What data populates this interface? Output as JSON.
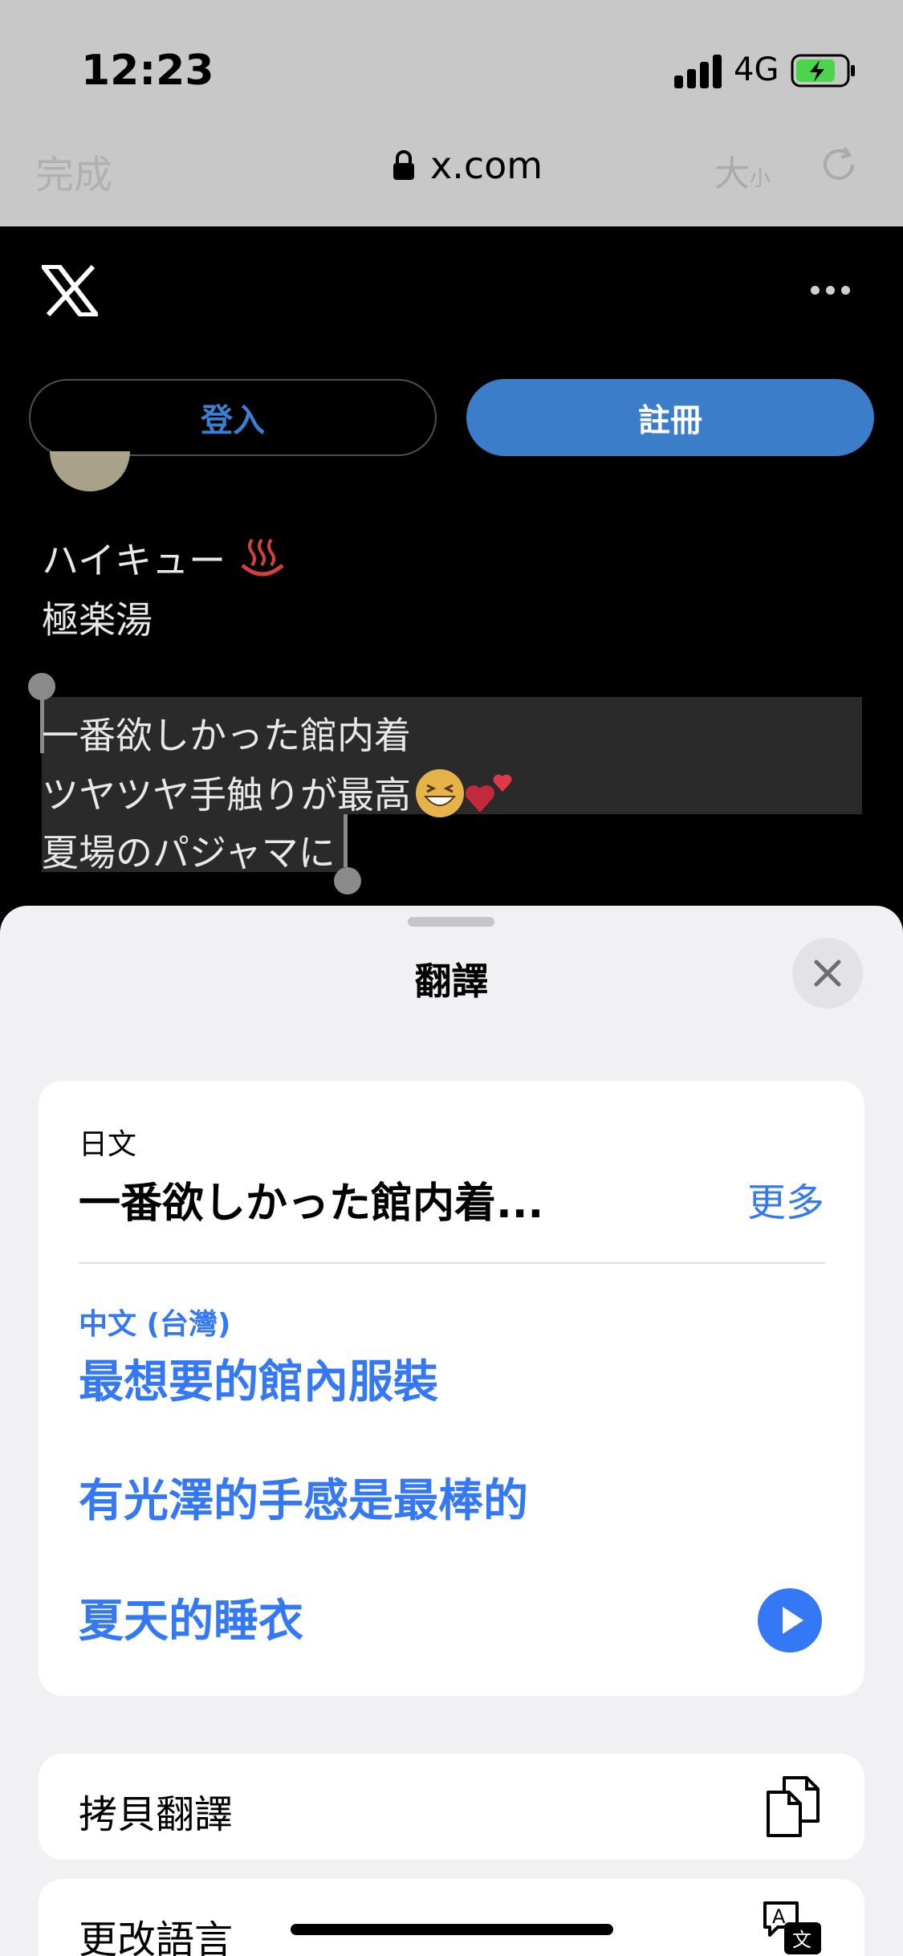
{
  "status_bar": {
    "time": "12:23",
    "network": "4G"
  },
  "browser": {
    "done_label": "完成",
    "url": "x.com",
    "text_size_label": "大",
    "text_size_small": "小"
  },
  "x_page": {
    "login_label": "登入",
    "signup_label": "註冊",
    "profile_name": "ハイキュー",
    "profile_sub": "極楽湯",
    "tweet_lines": [
      "一番欲しかった館内着",
      "ツヤツヤ手触りが最高",
      "夏場のパジャマに"
    ]
  },
  "translate_sheet": {
    "title": "翻譯",
    "source_language": "日文",
    "source_text": "一番欲しかった館内着...",
    "more_label": "更多",
    "target_language": "中文 (台灣)",
    "translation_lines": [
      "最想要的館內服裝",
      "有光澤的手感是最棒的",
      "夏天的睡衣"
    ],
    "actions": [
      {
        "label": "拷貝翻譯",
        "icon": "copy-icon"
      },
      {
        "label": "更改語言",
        "icon": "translate-icon"
      }
    ]
  },
  "colors": {
    "accent": "#3478f6",
    "signup": "#3b7dc8"
  }
}
